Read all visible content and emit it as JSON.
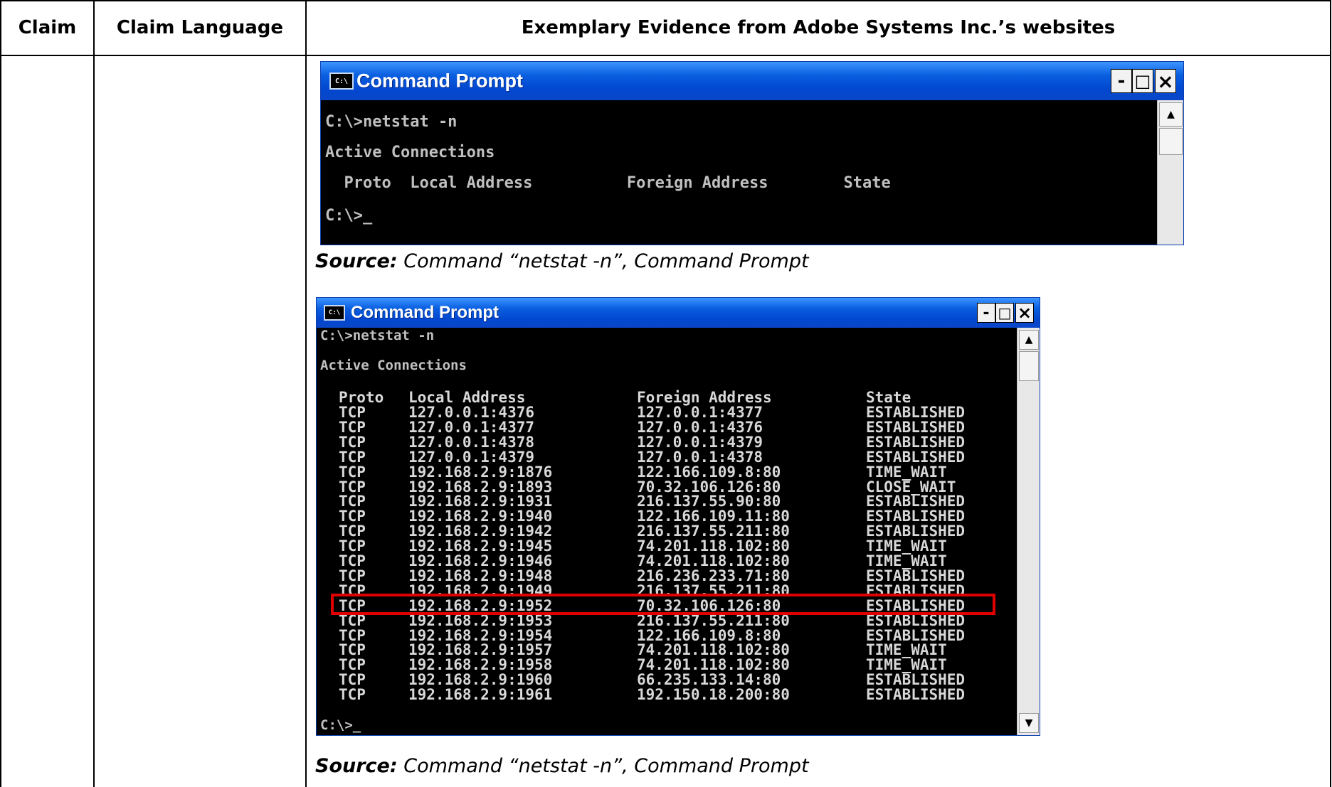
{
  "table": {
    "headers": {
      "claim": "Claim",
      "claim_language": "Claim Language",
      "evidence": "Exemplary Evidence from Adobe Systems Inc.’s websites"
    }
  },
  "window1": {
    "icon_text": "C:\\",
    "title": "Command Prompt",
    "buttons": {
      "minimize": "-",
      "maximize": "□",
      "close": "×"
    },
    "lines": {
      "command": "C:\\>netstat -n",
      "active": "Active Connections",
      "header": "  Proto  Local Address          Foreign Address        State",
      "prompt": "C:\\>_"
    }
  },
  "source1": {
    "label": "Source:",
    "text": " Command “netstat -n”, Command Prompt"
  },
  "window2": {
    "icon_text": "C:\\",
    "title": "Command Prompt",
    "buttons": {
      "minimize": "-",
      "maximize": "□",
      "close": "×"
    },
    "command": "C:\\>netstat -n",
    "active": "Active Connections",
    "columns": {
      "proto": "Proto",
      "local": "Local Address",
      "foreign": "Foreign Address",
      "state": "State"
    },
    "rows": [
      [
        "TCP",
        "127.0.0.1:4376",
        "127.0.0.1:4377",
        "ESTABLISHED"
      ],
      [
        "TCP",
        "127.0.0.1:4377",
        "127.0.0.1:4376",
        "ESTABLISHED"
      ],
      [
        "TCP",
        "127.0.0.1:4378",
        "127.0.0.1:4379",
        "ESTABLISHED"
      ],
      [
        "TCP",
        "127.0.0.1:4379",
        "127.0.0.1:4378",
        "ESTABLISHED"
      ],
      [
        "TCP",
        "192.168.2.9:1876",
        "122.166.109.8:80",
        "TIME_WAIT"
      ],
      [
        "TCP",
        "192.168.2.9:1893",
        "70.32.106.126:80",
        "CLOSE_WAIT"
      ],
      [
        "TCP",
        "192.168.2.9:1931",
        "216.137.55.90:80",
        "ESTABLISHED"
      ],
      [
        "TCP",
        "192.168.2.9:1940",
        "122.166.109.11:80",
        "ESTABLISHED"
      ],
      [
        "TCP",
        "192.168.2.9:1942",
        "216.137.55.211:80",
        "ESTABLISHED"
      ],
      [
        "TCP",
        "192.168.2.9:1945",
        "74.201.118.102:80",
        "TIME_WAIT"
      ],
      [
        "TCP",
        "192.168.2.9:1946",
        "74.201.118.102:80",
        "TIME_WAIT"
      ],
      [
        "TCP",
        "192.168.2.9:1948",
        "216.236.233.71:80",
        "ESTABLISHED"
      ],
      [
        "TCP",
        "192.168.2.9:1949",
        "216.137.55.211:80",
        "ESTABLISHED"
      ],
      [
        "TCP",
        "192.168.2.9:1952",
        "70.32.106.126:80",
        "ESTABLISHED"
      ],
      [
        "TCP",
        "192.168.2.9:1953",
        "216.137.55.211:80",
        "ESTABLISHED"
      ],
      [
        "TCP",
        "192.168.2.9:1954",
        "122.166.109.8:80",
        "ESTABLISHED"
      ],
      [
        "TCP",
        "192.168.2.9:1957",
        "74.201.118.102:80",
        "TIME_WAIT"
      ],
      [
        "TCP",
        "192.168.2.9:1958",
        "74.201.118.102:80",
        "TIME_WAIT"
      ],
      [
        "TCP",
        "192.168.2.9:1960",
        "66.235.133.14:80",
        "ESTABLISHED"
      ],
      [
        "TCP",
        "192.168.2.9:1961",
        "192.150.18.200:80",
        "ESTABLISHED"
      ]
    ],
    "highlighted_row": 13,
    "prompt": "C:\\>_",
    "highlight_color": "#e00000"
  },
  "source2": {
    "label": "Source:",
    "text": " Command “netstat -n”, Command Prompt"
  }
}
